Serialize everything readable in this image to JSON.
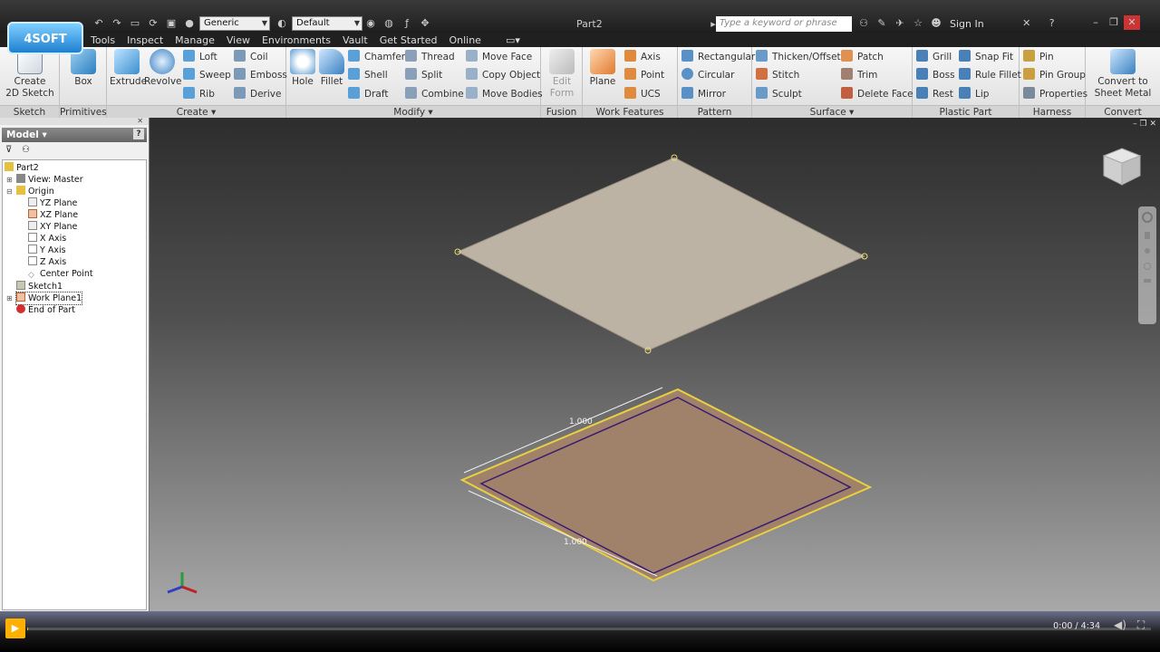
{
  "titlebar": {
    "title": "Part2",
    "style_combo": "Generic",
    "appearance_combo": "Default",
    "search_placeholder": "Type a keyword or phrase",
    "sign_in": "Sign In"
  },
  "logo": {
    "text": "4SOFT"
  },
  "menubar": {
    "items": [
      "Tools",
      "Inspect",
      "Manage",
      "View",
      "Environments",
      "Vault",
      "Get Started",
      "Online"
    ]
  },
  "ribbon": {
    "sketch": {
      "label": "Sketch",
      "create_sketch": "Create\n2D Sketch"
    },
    "primitives": {
      "label": "Primitives",
      "box": "Box"
    },
    "create": {
      "label": "Create",
      "extrude": "Extrude",
      "revolve": "Revolve",
      "loft": "Loft",
      "sweep": "Sweep",
      "rib": "Rib",
      "coil": "Coil",
      "emboss": "Emboss",
      "derive": "Derive"
    },
    "modify": {
      "label": "Modify",
      "hole": "Hole",
      "fillet": "Fillet",
      "chamfer": "Chamfer",
      "shell": "Shell",
      "draft": "Draft",
      "thread": "Thread",
      "split": "Split",
      "combine": "Combine",
      "move_face": "Move Face",
      "copy_object": "Copy Object",
      "move_bodies": "Move Bodies"
    },
    "fusion": {
      "label": "Fusion",
      "edit_form": "Edit\nForm"
    },
    "work_features": {
      "label": "Work Features",
      "plane": "Plane",
      "axis": "Axis",
      "point": "Point",
      "ucs": "UCS"
    },
    "pattern": {
      "label": "Pattern",
      "rectangular": "Rectangular",
      "circular": "Circular",
      "mirror": "Mirror"
    },
    "surface": {
      "label": "Surface",
      "thicken": "Thicken/Offset",
      "stitch": "Stitch",
      "sculpt": "Sculpt",
      "patch": "Patch",
      "trim": "Trim",
      "delete_face": "Delete Face"
    },
    "plastic_part": {
      "label": "Plastic Part",
      "grill": "Grill",
      "boss": "Boss",
      "rest": "Rest",
      "snap_fit": "Snap Fit",
      "rule_fillet": "Rule Fillet",
      "lip": "Lip"
    },
    "harness": {
      "label": "Harness",
      "pin": "Pin",
      "pin_group": "Pin Group",
      "properties": "Properties"
    },
    "convert": {
      "label": "Convert",
      "convert_sheet_metal": "Convert to\nSheet Metal"
    }
  },
  "browser": {
    "tab": "Model",
    "tree": [
      "Part2",
      "View: Master",
      "Origin",
      "YZ Plane",
      "XZ Plane",
      "XY Plane",
      "X Axis",
      "Y Axis",
      "Z Axis",
      "Center Point",
      "Sketch1",
      "Work Plane1",
      "End of Part"
    ]
  },
  "viewport": {
    "dim_top": "1.000",
    "dim_bottom": "1.000"
  },
  "video": {
    "time": "0:00 / 4:34"
  }
}
